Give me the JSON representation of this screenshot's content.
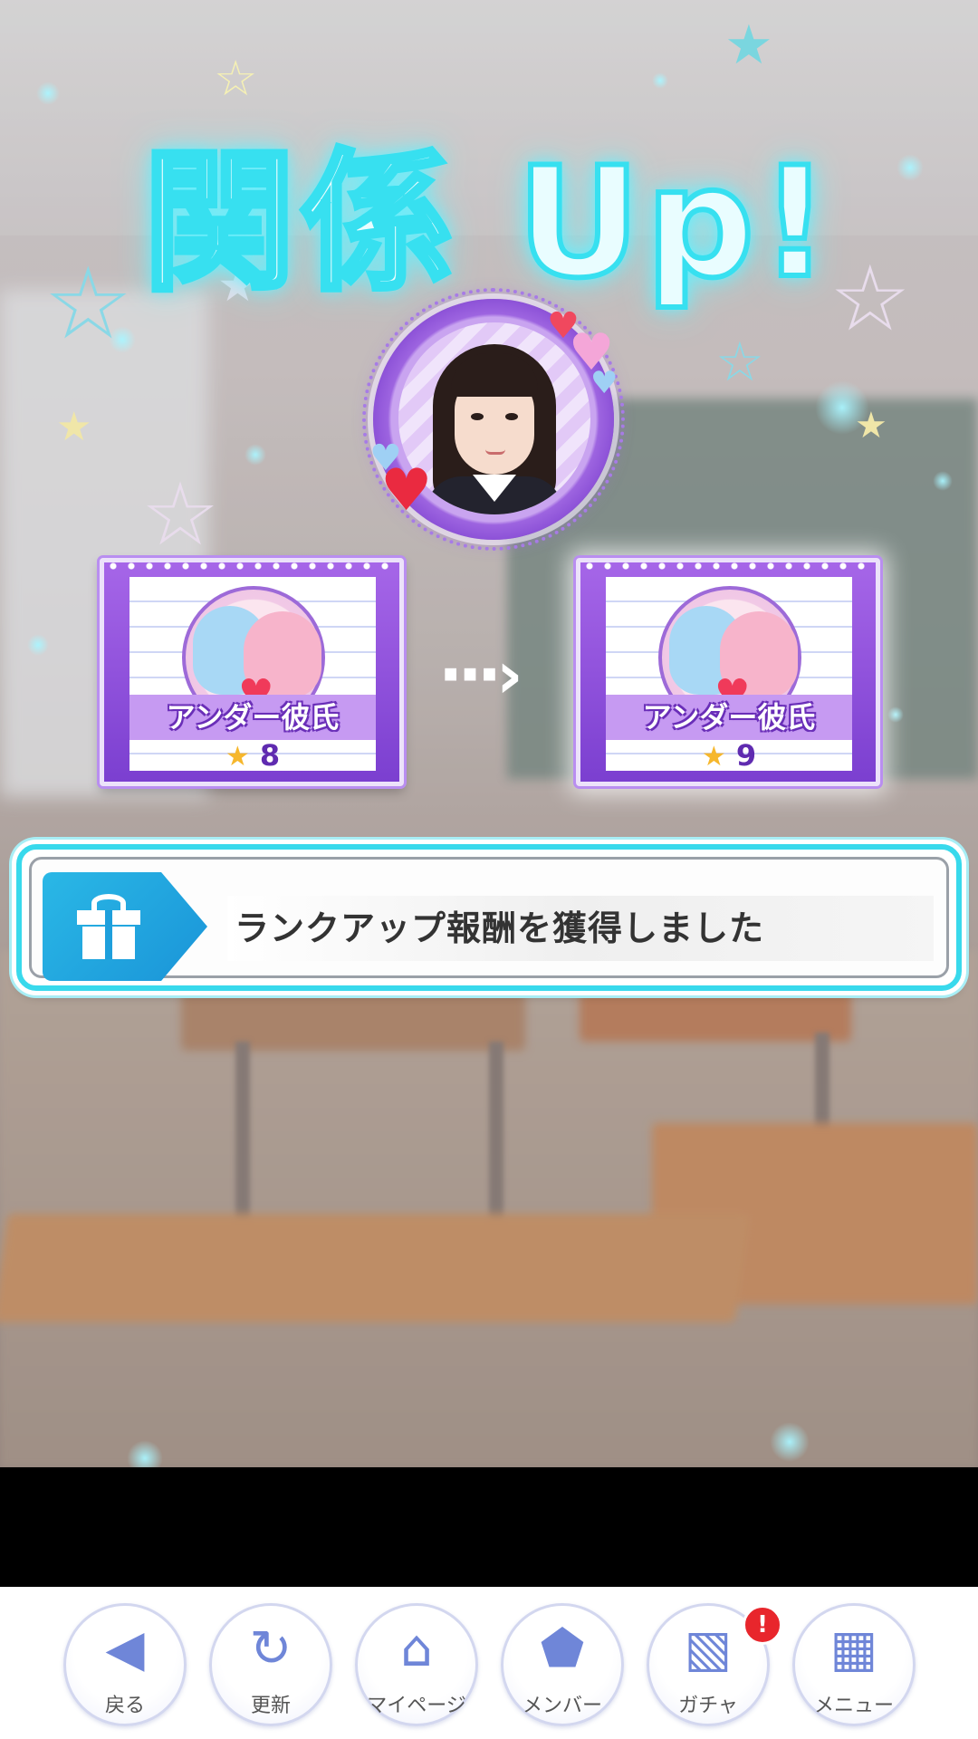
{
  "title": "関係 Up!",
  "member": {
    "avatar_icon": "member-portrait",
    "heart_glyph": "♥"
  },
  "rank_cards": {
    "before": {
      "title": "アンダー彼氏",
      "level": "8",
      "star_glyph": "★"
    },
    "after": {
      "title": "アンダー彼氏",
      "level": "9",
      "star_glyph": "★"
    },
    "arrow_glyph": "···›"
  },
  "reward": {
    "icon": "gift-icon",
    "message": "ランクアップ報酬を獲得しました"
  },
  "nav": {
    "back": {
      "icon": "◀",
      "label": "戻る"
    },
    "refresh": {
      "icon": "↻",
      "label": "更新"
    },
    "mypage": {
      "icon": "⌂",
      "label": "マイページ"
    },
    "member": {
      "icon": "⬟",
      "label": "メンバー"
    },
    "gacha": {
      "icon": "▧",
      "label": "ガチャ",
      "badge": "!"
    },
    "menu": {
      "icon": "▦",
      "label": "メニュー"
    }
  },
  "colors": {
    "title_glow": "#37e0f0",
    "card_purple": "#7b3fd0",
    "reward_accent": "#2ab8e6",
    "nav_icon": "#6f86d8",
    "badge_red": "#e8262c"
  }
}
